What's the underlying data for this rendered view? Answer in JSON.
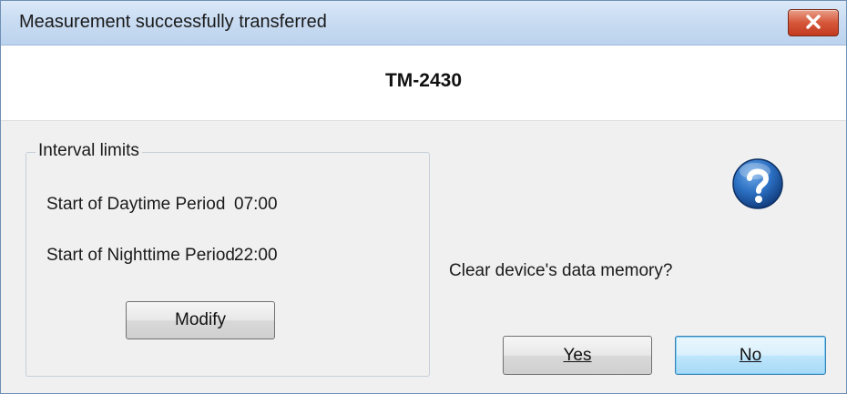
{
  "window": {
    "title": "Measurement successfully transferred",
    "close_icon": "close-icon"
  },
  "header": {
    "device_name": "TM-2430"
  },
  "interval_limits": {
    "legend": "Interval limits",
    "daytime_label": "Start of Daytime Period",
    "daytime_value": "07:00",
    "nighttime_label": "Start of Nighttime Period",
    "nighttime_value": "22:00",
    "modify_label": "Modify"
  },
  "dialog": {
    "icon": "question-icon",
    "icon_color": "#1f5fa8",
    "prompt": "Clear device's data memory?",
    "yes_label": "Yes",
    "no_label": "No"
  }
}
